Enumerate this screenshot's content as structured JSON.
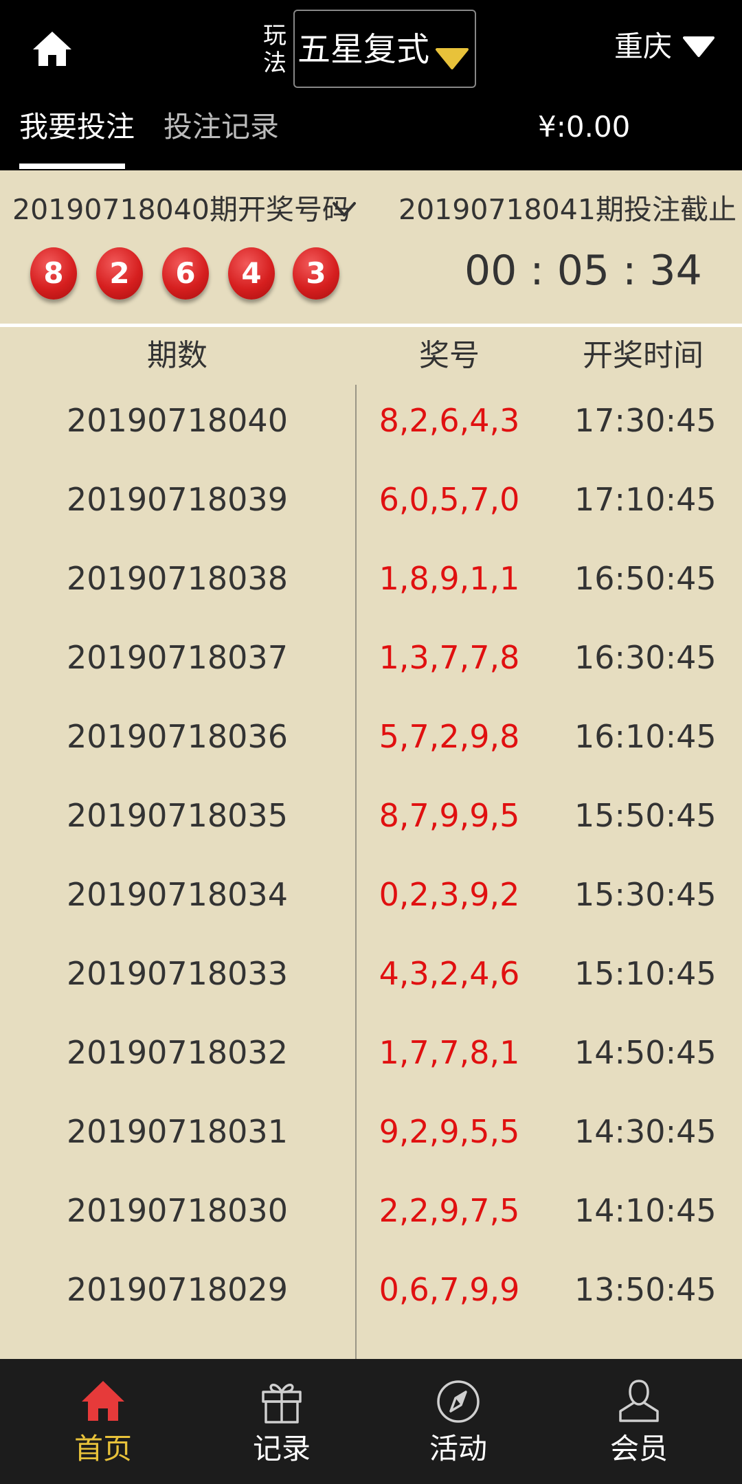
{
  "colors": {
    "header_bg": "#000000",
    "page_bg": "#E6DDC0",
    "ball_red": "#D61F1F",
    "number_red": "#E01010",
    "nav_bg": "#1C1C1C",
    "nav_active": "#E8C23A",
    "select_arrow": "#E8C23A"
  },
  "header": {
    "play_label": "玩法",
    "play_select_value": "五星复式",
    "region": "重庆",
    "tabs": [
      {
        "label": "我要投注"
      },
      {
        "label": "投注记录"
      }
    ],
    "balance": "¥:0.00"
  },
  "draw": {
    "last_issue": "20190718040期开奖号码",
    "last_numbers": [
      "8",
      "2",
      "6",
      "4",
      "3"
    ],
    "next_issue": "20190718041期投注截止",
    "countdown": "00 : 05 : 34"
  },
  "table": {
    "headers": {
      "issue": "期数",
      "numbers": "奖号",
      "time": "开奖时间"
    },
    "rows": [
      {
        "issue": "20190718040",
        "numbers": "8,2,6,4,3",
        "time": "17:30:45"
      },
      {
        "issue": "20190718039",
        "numbers": "6,0,5,7,0",
        "time": "17:10:45"
      },
      {
        "issue": "20190718038",
        "numbers": "1,8,9,1,1",
        "time": "16:50:45"
      },
      {
        "issue": "20190718037",
        "numbers": "1,3,7,7,8",
        "time": "16:30:45"
      },
      {
        "issue": "20190718036",
        "numbers": "5,7,2,9,8",
        "time": "16:10:45"
      },
      {
        "issue": "20190718035",
        "numbers": "8,7,9,9,5",
        "time": "15:50:45"
      },
      {
        "issue": "20190718034",
        "numbers": "0,2,3,9,2",
        "time": "15:30:45"
      },
      {
        "issue": "20190718033",
        "numbers": "4,3,2,4,6",
        "time": "15:10:45"
      },
      {
        "issue": "20190718032",
        "numbers": "1,7,7,8,1",
        "time": "14:50:45"
      },
      {
        "issue": "20190718031",
        "numbers": "9,2,9,5,5",
        "time": "14:30:45"
      },
      {
        "issue": "20190718030",
        "numbers": "2,2,9,7,5",
        "time": "14:10:45"
      },
      {
        "issue": "20190718029",
        "numbers": "0,6,7,9,9",
        "time": "13:50:45"
      }
    ]
  },
  "nav": {
    "items": [
      {
        "label": "首页",
        "icon": "home-icon"
      },
      {
        "label": "记录",
        "icon": "gift-icon"
      },
      {
        "label": "活动",
        "icon": "compass-icon"
      },
      {
        "label": "会员",
        "icon": "user-icon"
      }
    ]
  }
}
